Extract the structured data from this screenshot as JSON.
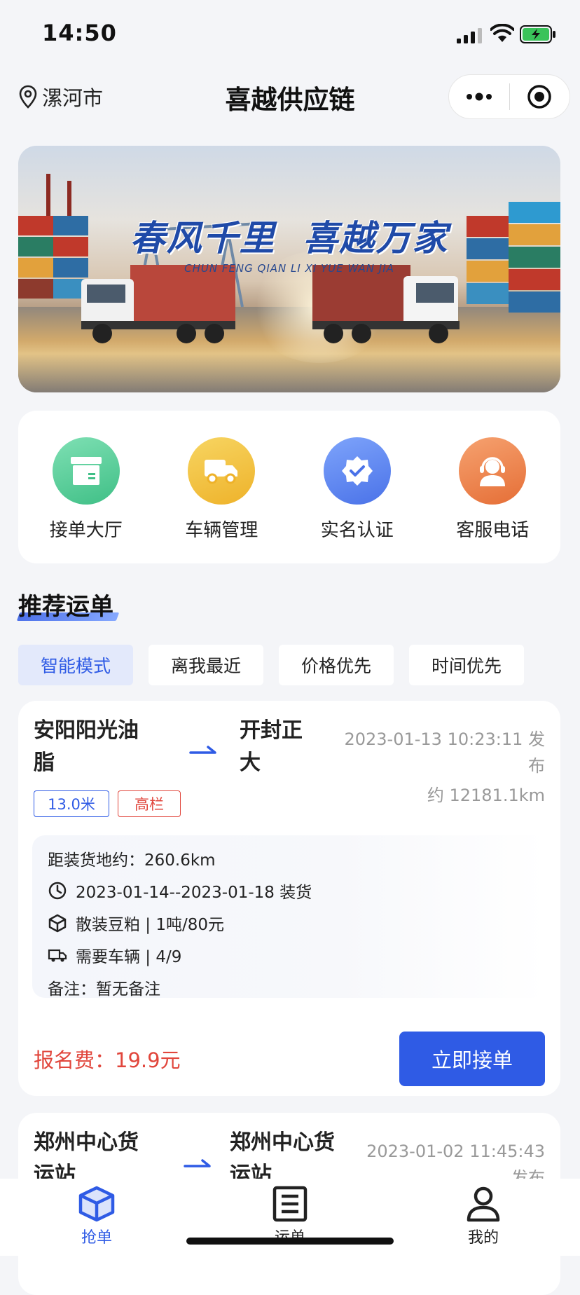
{
  "status_bar": {
    "time": "14:50"
  },
  "nav": {
    "location": "漯河市",
    "title": "喜越供应链"
  },
  "banner": {
    "headline": "春风千里  喜越万家",
    "subtitle": "CHUN FENG QIAN LI XI YUE WAN JIA"
  },
  "menu": [
    {
      "label": "接单大厅",
      "icon": "package-icon",
      "color": "#5fcf9b"
    },
    {
      "label": "车辆管理",
      "icon": "truck-icon",
      "color": "#f2bf3c"
    },
    {
      "label": "实名认证",
      "icon": "verified-badge-icon",
      "color": "#5b86f0"
    },
    {
      "label": "客服电话",
      "icon": "customer-service-icon",
      "color": "#ee874e"
    }
  ],
  "section": {
    "title": "推荐运单"
  },
  "filters": [
    "智能模式",
    "离我最近",
    "价格优先",
    "时间优先"
  ],
  "orders": [
    {
      "from_line1": "安阳阳光油",
      "from_line2": "脂",
      "to_line1": "开封正",
      "to_line2": "大",
      "published_line1": "2023-01-13 10:23:11 发",
      "published_line2": "布",
      "distance": "约 12181.1km",
      "tags": [
        "13.0米",
        "高栏"
      ],
      "pickup_distance": "距装货地约：260.6km",
      "load_time": "2023-01-14--2023-01-18 装货",
      "cargo": "散装豆粕  |  1吨/80元",
      "vehicles": "需要车辆  |  4/9",
      "remark": "备注：暂无备注",
      "fee": "报名费：19.9元",
      "button": "立即接单"
    },
    {
      "from_line1": "郑州中心货",
      "from_line2": "运站",
      "to_line1": "郑州中心货",
      "to_line2": "运站",
      "published_line1": "2023-01-02 11:45:43",
      "published_line2": "发布"
    }
  ],
  "tabbar": [
    {
      "label": "抢单",
      "icon": "cube-icon",
      "active": true
    },
    {
      "label": "运单",
      "icon": "document-list-icon",
      "active": false
    },
    {
      "label": "我的",
      "icon": "user-icon",
      "active": false
    }
  ],
  "colors": {
    "primary": "#2f5be5",
    "fee_red": "#e1463c",
    "tag_red": "#e1463c"
  }
}
